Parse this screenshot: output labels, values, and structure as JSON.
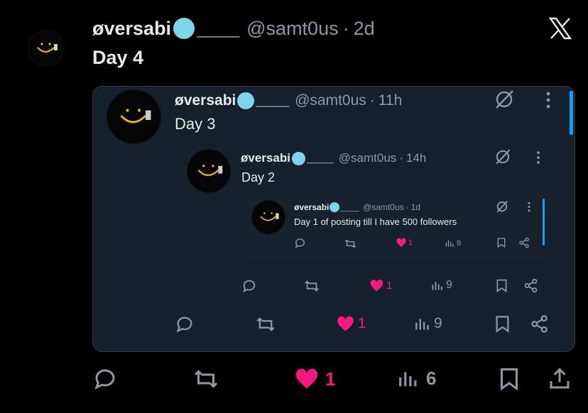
{
  "post": {
    "name": "øversabi",
    "name_suffix": "____",
    "handle": "@samt0us",
    "dot": "·",
    "time": "2d",
    "text": "Day 4",
    "actions": {
      "likes": "1",
      "views": "6"
    }
  },
  "quote1": {
    "name": "øversabi",
    "name_suffix": "____",
    "handle": "@samt0us",
    "dot": "·",
    "time": "11h",
    "text": "Day 3",
    "actions": {
      "likes": "1",
      "views": "9"
    }
  },
  "quote2": {
    "name": "øversabi",
    "name_suffix": "____",
    "handle": "@samt0us",
    "dot": "·",
    "time": "14h",
    "text": "Day 2",
    "actions": {
      "likes": "1",
      "views": "9"
    }
  },
  "quote3": {
    "name": "øversabi",
    "name_suffix": "____",
    "handle": "@samt0us",
    "dot": "·",
    "time": "1d",
    "text": "Day 1 of posting till I have 500 followers",
    "actions": {
      "likes": "1",
      "views": "9"
    }
  },
  "colors": {
    "background": "#000000",
    "card": "#15202b",
    "like": "#f91880",
    "muted": "#8b98a5",
    "accent": "#1d9bf0"
  },
  "icons": [
    "x-logo-icon",
    "grok-icon",
    "more-icon",
    "reply-icon",
    "repost-icon",
    "heart-icon",
    "views-icon",
    "bookmark-icon",
    "share-icon",
    "upload-icon",
    "cold-face-emoji-icon"
  ]
}
